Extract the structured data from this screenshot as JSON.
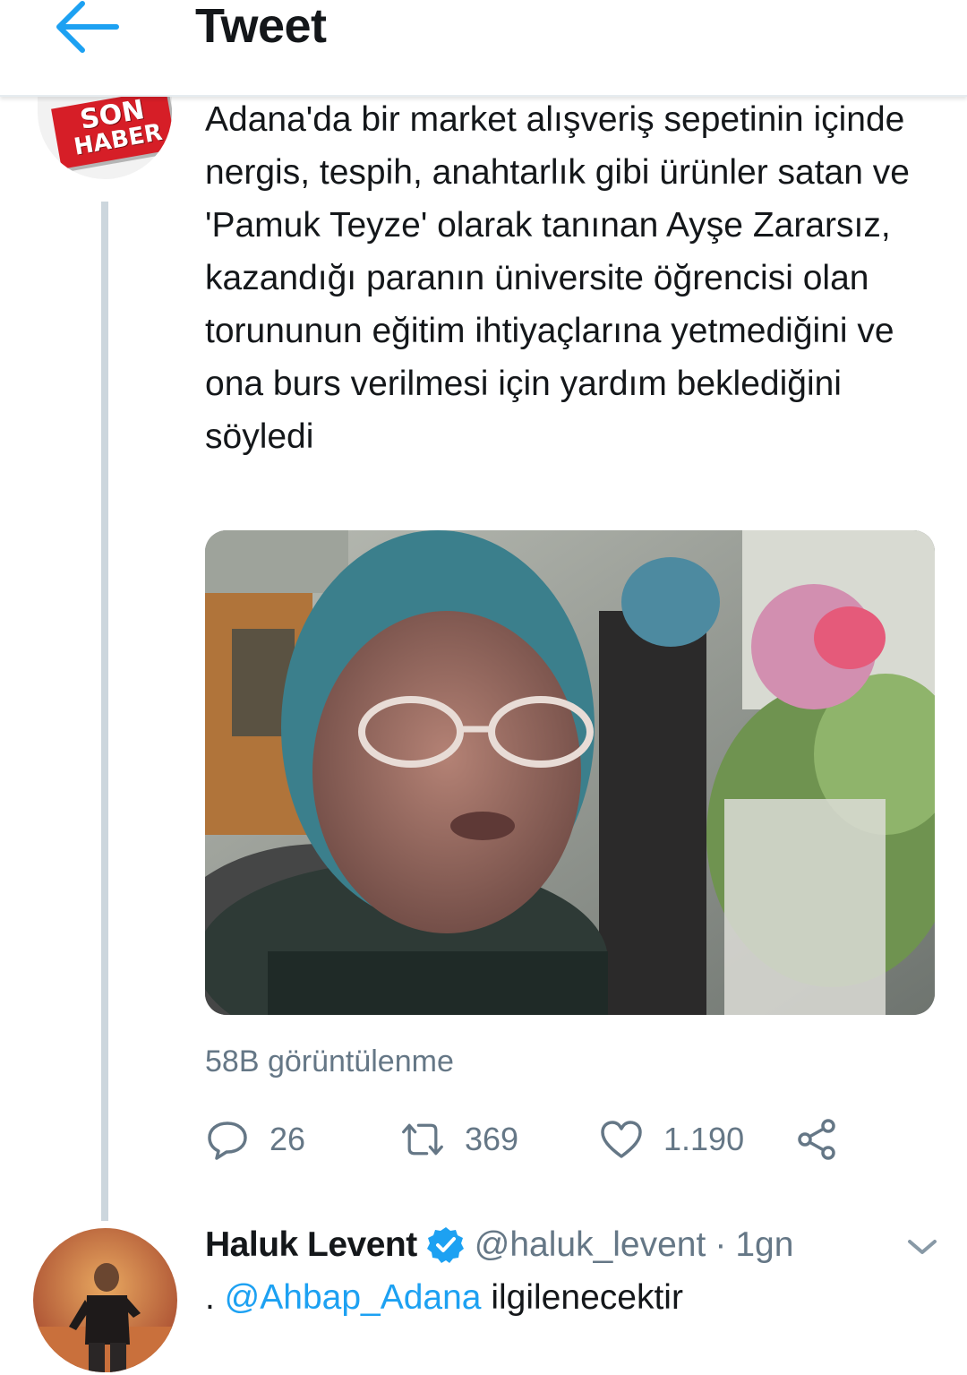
{
  "header": {
    "title": "Tweet",
    "back_icon": "arrow-left-icon",
    "accent_color": "#1da1f2"
  },
  "tweet": {
    "avatar_logo_text_1": "SON",
    "avatar_logo_text_2": "HABER",
    "text": "Adana'da bir market alışveriş sepetinin içinde nergis, tespih, anahtarlık gibi ürünler satan ve 'Pamuk Teyze' olarak tanınan Ayşe Zararsız, kazandığı paranın üniversite öğrencisi olan torununun eğitim ihtiyaçlarına yetmediğini ve ona burs verilmesi için yardım beklediğini söyledi",
    "views": "58B görüntülenme",
    "actions": {
      "reply_count": "26",
      "retweet_count": "369",
      "like_count": "1.190"
    }
  },
  "reply": {
    "name": "Haluk Levent",
    "verified": true,
    "handle": "@haluk_levent",
    "separator": "·",
    "time": "1gn",
    "text_prefix": ". ",
    "mention": "@Ahbap_Adana",
    "text_suffix": " ilgilenecektir"
  },
  "colors": {
    "secondary_text": "#657786",
    "thread_line": "#ccd6dd",
    "verified_badge": "#1da1f2"
  }
}
